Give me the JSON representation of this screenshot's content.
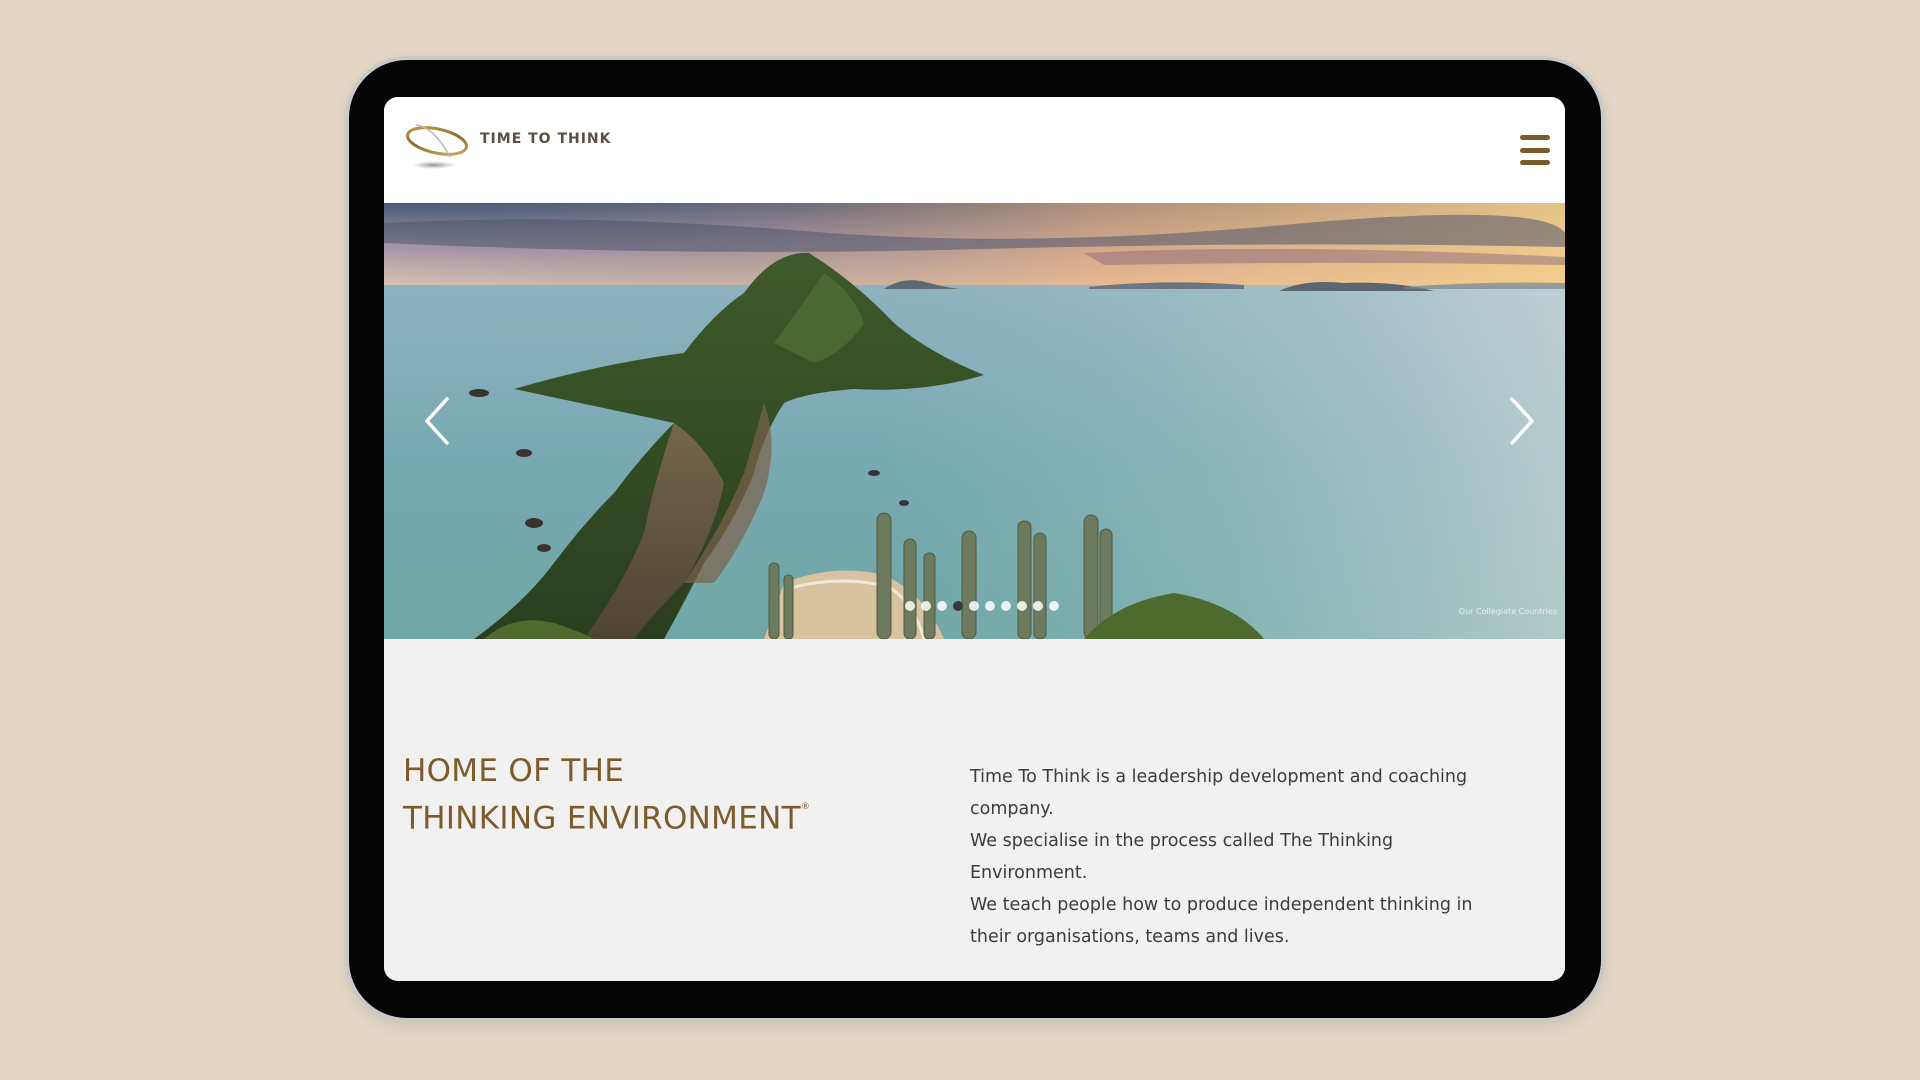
{
  "header": {
    "logo_text": "TIME TO THINK",
    "menu_icon": "hamburger-menu-icon",
    "brand_color": "#7a5a2b"
  },
  "hero": {
    "image_description_icon": "coastal-landscape-image",
    "prev_icon": "chevron-left-icon",
    "next_icon": "chevron-right-icon",
    "slide_count": 10,
    "active_slide": 4,
    "caption": "Our Collegiate Countries"
  },
  "content": {
    "headline_line1": "HOME OF THE",
    "headline_line2": "THINKING ENVIRONMENT",
    "headline_mark": "®",
    "headline_color": "#7d5b2b",
    "paragraphs": [
      "Time To Think is a leadership development and coaching company.",
      "We specialise in the process called The Thinking Environment.",
      "We teach people how to produce independent thinking in their organisations, teams and lives."
    ]
  }
}
